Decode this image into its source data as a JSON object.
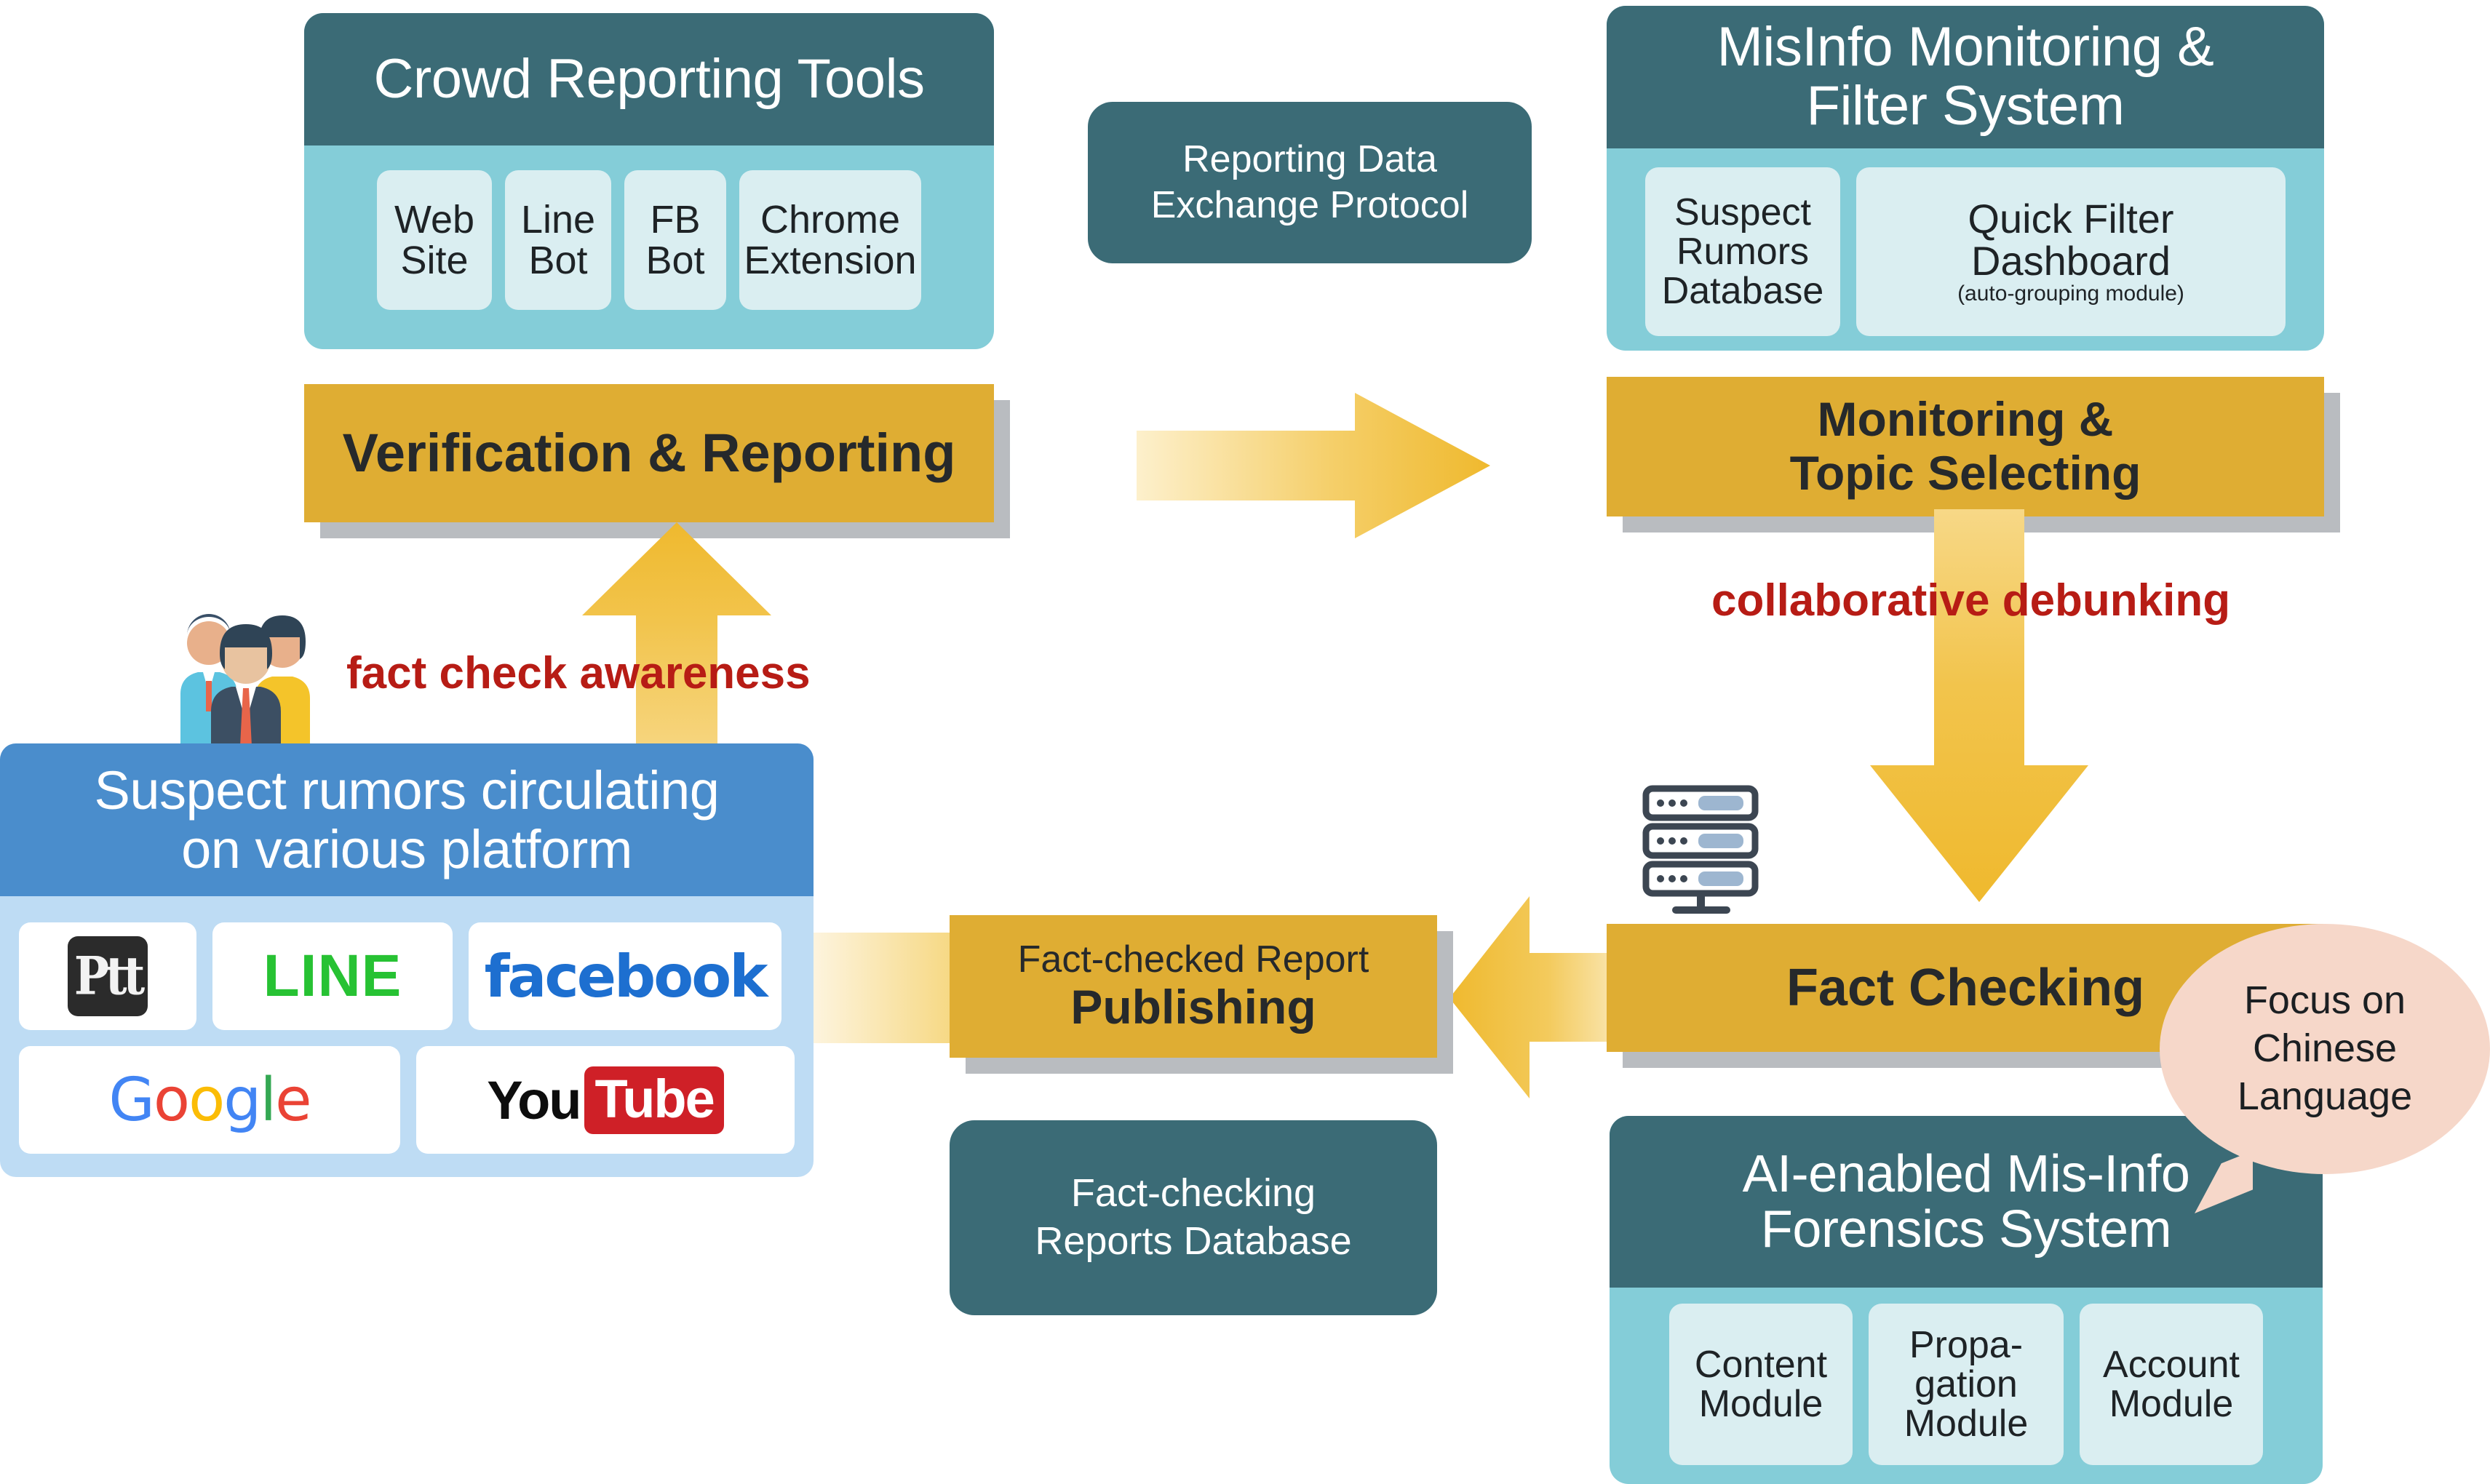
{
  "colors": {
    "teal_header": "#3b6b76",
    "teal_body": "#84cdd8",
    "chip": "#daeef1",
    "gold": "#dfad33",
    "gold_light": "#fbe8b0",
    "shadow_grey": "#b9bcc0",
    "blue_header": "#4a8dcc",
    "blue_body": "#bedcf4",
    "red_label": "#b71c15",
    "bubble_peach": "#f6d7c9"
  },
  "crowd_reporting_tools": {
    "title": "Crowd Reporting Tools",
    "chips": [
      {
        "line1": "Web",
        "line2": "Site"
      },
      {
        "line1": "Line",
        "line2": "Bot"
      },
      {
        "line1": "FB",
        "line2": "Bot"
      },
      {
        "line1": "Chrome",
        "line2": "Extension"
      }
    ]
  },
  "reporting_protocol": {
    "line1": "Reporting Data",
    "line2": "Exchange Protocol"
  },
  "misinfo_monitoring": {
    "title_line1": "MisInfo Monitoring &",
    "title_line2": "Filter System",
    "chips": [
      {
        "line1": "Suspect",
        "line2": "Rumors",
        "line3": "Database"
      },
      {
        "line1": "Quick Filter",
        "line2": "Dashboard",
        "sub": "(auto-grouping module)"
      }
    ]
  },
  "bars": {
    "verification": {
      "line1": "Verification & Reporting"
    },
    "monitoring": {
      "line1": "Monitoring &",
      "line2": "Topic Selecting",
      "ghost": "Topic Selecting"
    },
    "publishing": {
      "line1": "Fact-checked Report",
      "line2": "Publishing"
    },
    "fact_checking": {
      "line1": "Fact Checking"
    }
  },
  "labels": {
    "fact_check_awareness": "fact check awareness",
    "collaborative_debunking": "collaborative debunking"
  },
  "suspect_rumors": {
    "title_line1": "Suspect rumors circulating",
    "title_line2": "on various platform",
    "platforms": [
      "Ptt",
      "LINE",
      "facebook",
      "Google",
      "YouTube"
    ]
  },
  "fact_checking_db": {
    "line1": "Fact-checking",
    "line2": "Reports  Database"
  },
  "focus_bubble": {
    "line1": "Focus on",
    "line2": "Chinese",
    "line3": "Language"
  },
  "ai_forensics": {
    "title_line1": "AI-enabled Mis-Info",
    "title_line2": "Forensics System",
    "chips": [
      {
        "line1": "Content",
        "line2": "Module"
      },
      {
        "line1": "Propa-",
        "line2": "gation",
        "line3": "Module"
      },
      {
        "line1": "Account",
        "line2": "Module"
      }
    ]
  },
  "icons": {
    "people": "people-group-icon",
    "server": "server-stack-icon",
    "arrow_right": "arrow-right-icon",
    "arrow_up": "arrow-up-icon",
    "arrow_down": "arrow-down-icon",
    "arrow_left": "arrow-left-icon"
  }
}
